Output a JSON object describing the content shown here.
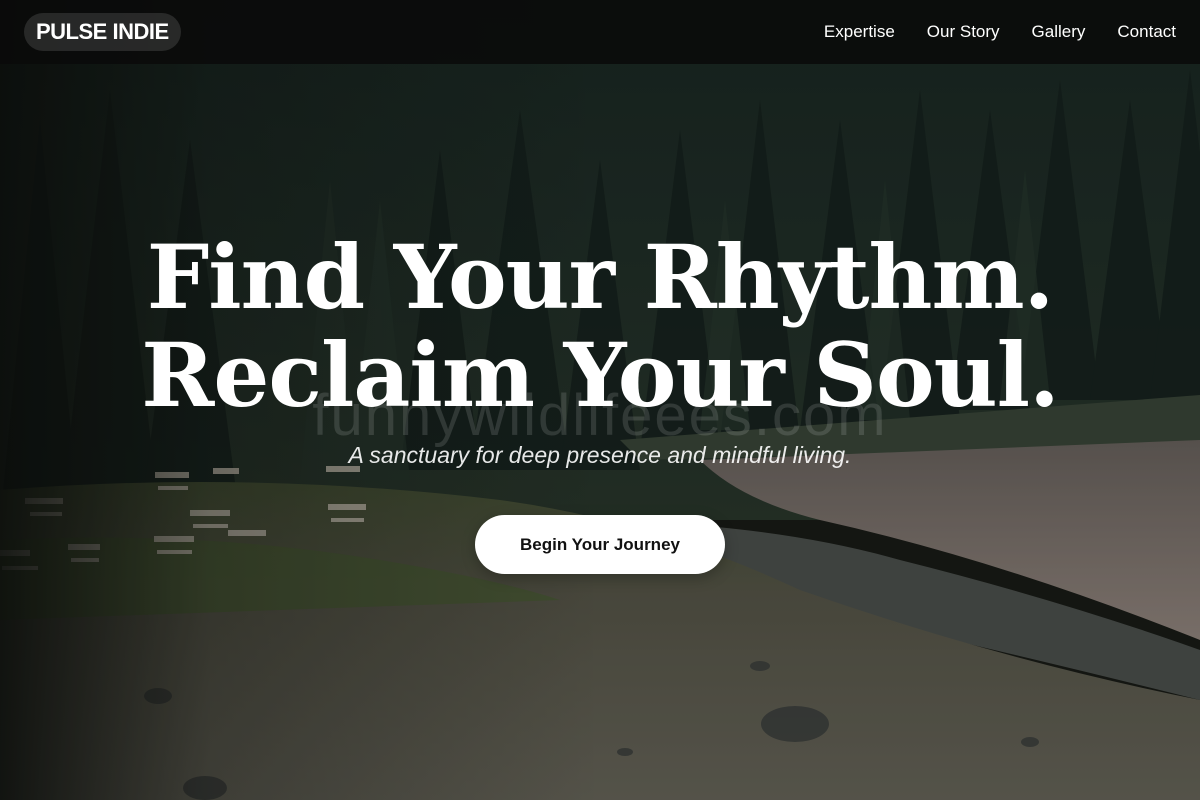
{
  "nav": {
    "brand": "PULSE INDIE",
    "links": [
      "Expertise",
      "Our Story",
      "Gallery",
      "Contact"
    ]
  },
  "hero": {
    "headline_line1": "Find Your Rhythm.",
    "headline_line2": "Reclaim Your Soul.",
    "tagline": "A sanctuary for deep presence and mindful living.",
    "cta_label": "Begin Your Journey",
    "watermark": "funnywildlifeees.com"
  },
  "colors": {
    "nav_background": "#0a0a0a",
    "text": "#ffffff",
    "cta_background": "#ffffff",
    "cta_text": "#111111",
    "forest": "#1f2b24",
    "lake": "#8a7f78",
    "meadow": "#4d5a3c"
  }
}
